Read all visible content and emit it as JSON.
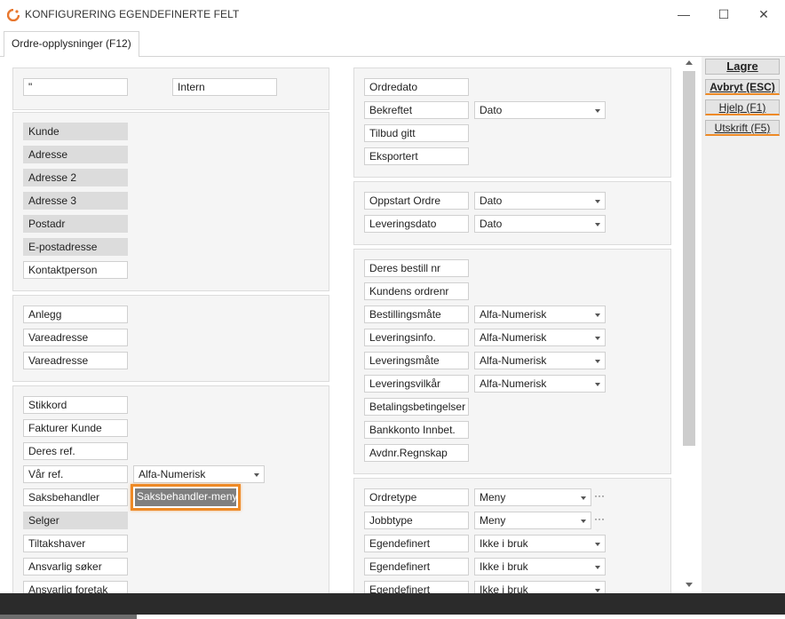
{
  "window": {
    "title": "KONFIGURERING EGENDEFINERTE FELT",
    "minimize": "—",
    "maximize": "☐",
    "close": "✕"
  },
  "tabs": [
    {
      "label": "Ordre-opplysninger (F12)",
      "active": true
    }
  ],
  "left": {
    "top_fields": [
      "\"",
      "Intern"
    ],
    "customer": [
      "Kunde",
      "Adresse",
      "Adresse 2",
      "Adresse 3",
      "Postadr",
      "E-postadresse",
      "Kontaktperson"
    ],
    "facility": [
      "Anlegg",
      "Vareadresse",
      "Vareadresse"
    ],
    "refs": [
      "Stikkord",
      "Fakturer Kunde",
      "Deres ref.",
      "Vår ref.",
      "Saksbehandler",
      "Selger",
      "Tiltakshaver",
      "Ansvarlig søker",
      "Ansvarlig foretak"
    ],
    "var_ref_type": "Alfa-Numerisk",
    "saksbehandler_menu": "Saksbehandler-meny"
  },
  "right": {
    "dates1": [
      "Ordredato",
      "Bekreftet",
      "Tilbud gitt",
      "Eksportert"
    ],
    "bekreftet_type": "Dato",
    "dates2": [
      "Oppstart Ordre",
      "Leveringsdato"
    ],
    "dates2_types": [
      "Dato",
      "Dato"
    ],
    "delivery": [
      "Deres bestill nr",
      "Kundens ordrenr",
      "Bestillingsmåte",
      "Leveringsinfo.",
      "Leveringsmåte",
      "Leveringsvilkår",
      "Betalingsbetingelser",
      "Bankkonto Innbet.",
      "Avdnr.Regnskap"
    ],
    "delivery_types": [
      "Alfa-Numerisk",
      "Alfa-Numerisk",
      "Alfa-Numerisk",
      "Alfa-Numerisk"
    ],
    "custom": [
      "Ordretype",
      "Jobbtype",
      "Egendefinert",
      "Egendefinert",
      "Egendefinert"
    ],
    "custom_types": [
      "Meny",
      "Meny",
      "Ikke i bruk",
      "Ikke i bruk",
      "Ikke i bruk"
    ],
    "more": "···"
  },
  "actions": {
    "save": "Lagre",
    "cancel": "Avbryt (ESC)",
    "help": "Hjelp (F1)",
    "print": "Utskrift (F5)"
  },
  "colors": {
    "accent": "#ee8a26",
    "selected_bg": "#7f7f7f",
    "status_bar": "#2b2b2b"
  }
}
